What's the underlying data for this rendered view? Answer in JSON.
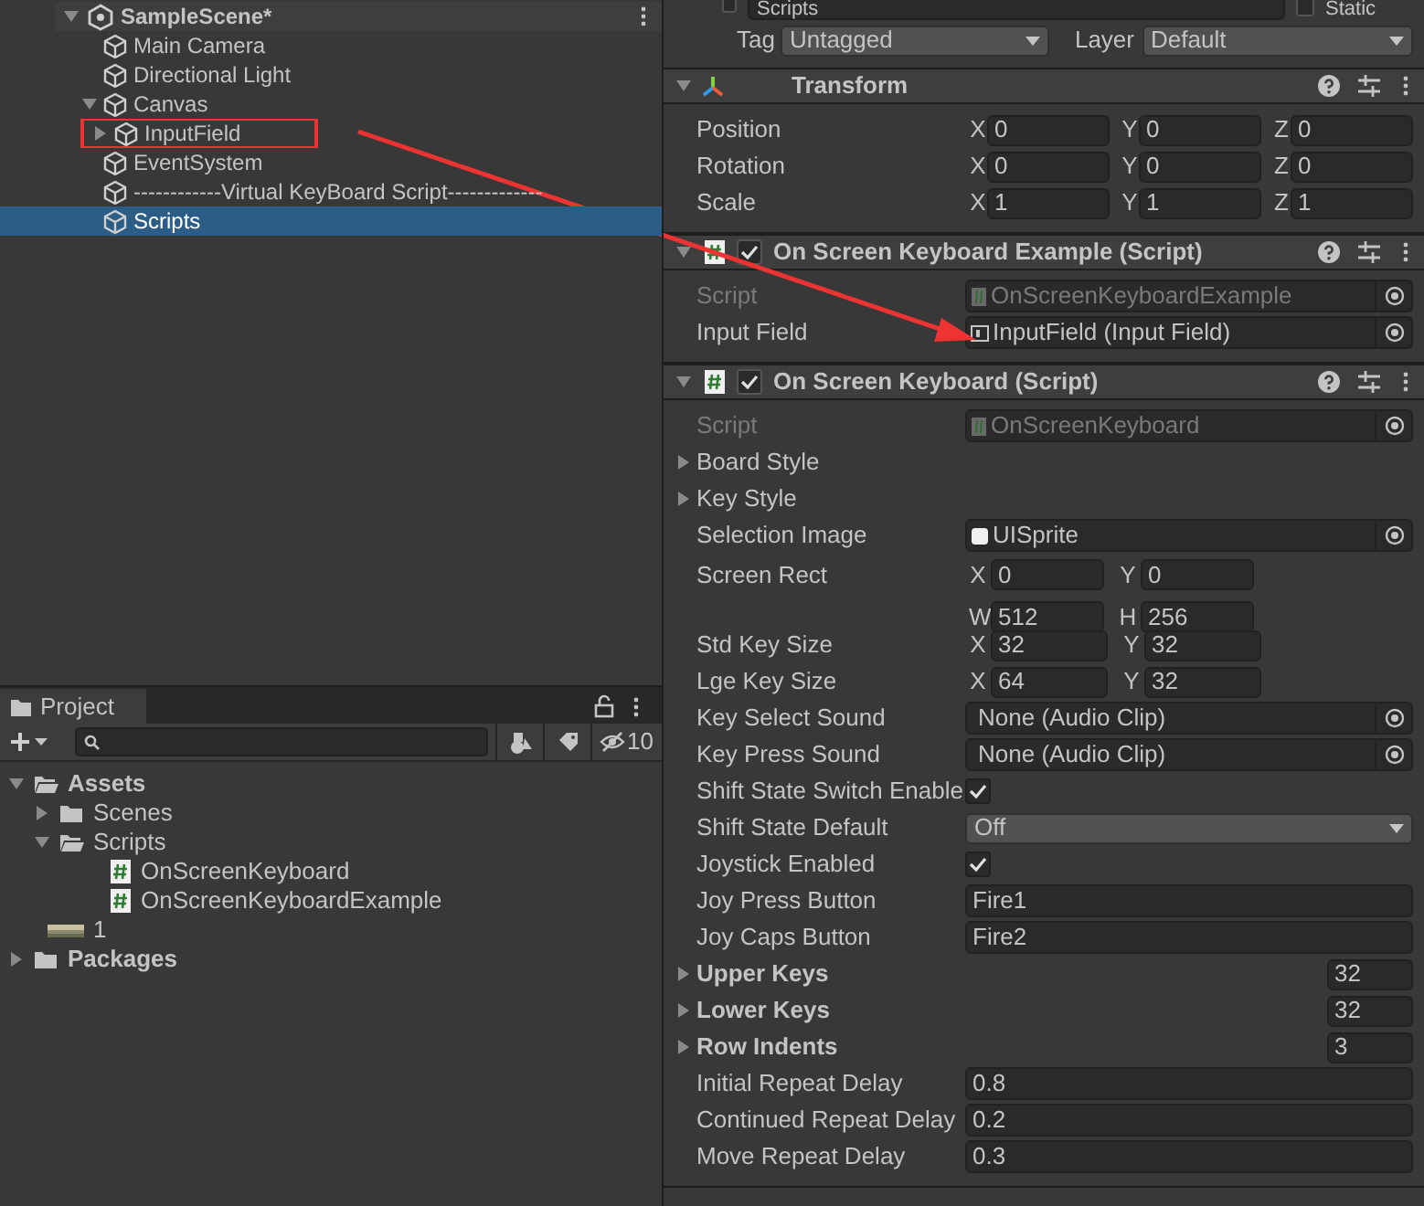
{
  "hierarchy": {
    "scene": "SampleScene*",
    "items": [
      {
        "name": "Main Camera",
        "selected": false,
        "annotated": false
      },
      {
        "name": "Directional Light",
        "selected": false,
        "annotated": false
      },
      {
        "name": "Canvas",
        "expanded": true,
        "selected": false,
        "annotated": false,
        "children": [
          {
            "name": "InputField",
            "expanded": false,
            "selected": false,
            "annotated": true
          }
        ]
      },
      {
        "name": "EventSystem",
        "selected": false,
        "annotated": false
      },
      {
        "name": "------------Virtual KeyBoard Script-------------",
        "selected": false,
        "annotated": false
      },
      {
        "name": "Scripts",
        "selected": true,
        "annotated": false
      }
    ]
  },
  "project": {
    "tab": "Project",
    "hidden_count": "10",
    "items": [
      {
        "name": "Assets",
        "kind": "folder",
        "bold": true,
        "expanded": true,
        "children": [
          {
            "name": "Scenes",
            "kind": "folder",
            "bold": false,
            "expanded": false
          },
          {
            "name": "Scripts",
            "kind": "folder",
            "bold": false,
            "expanded": true,
            "children": [
              {
                "name": "OnScreenKeyboard",
                "kind": "script",
                "bold": false
              },
              {
                "name": "OnScreenKeyboardExample",
                "kind": "script",
                "bold": false
              }
            ]
          },
          {
            "name": "1",
            "bold": false
          }
        ]
      },
      {
        "name": "Packages",
        "kind": "folder",
        "bold": true,
        "expanded": false
      }
    ]
  },
  "inspector": {
    "active": false,
    "name": "Scripts",
    "static": false,
    "static_label": "Static",
    "tag_label": "Tag",
    "tag": "Untagged",
    "layer_label": "Layer",
    "layer": "Default",
    "components": [
      {
        "title": "Transform",
        "kind": "transform",
        "rows": [
          {
            "kind": "vector3",
            "label": "Position",
            "fields": [
              {
                "axis": "X",
                "value": "0"
              },
              {
                "axis": "Y",
                "value": "0"
              },
              {
                "axis": "Z",
                "value": "0"
              }
            ]
          },
          {
            "kind": "vector3",
            "label": "Rotation",
            "fields": [
              {
                "axis": "X",
                "value": "0"
              },
              {
                "axis": "Y",
                "value": "0"
              },
              {
                "axis": "Z",
                "value": "0"
              }
            ]
          },
          {
            "kind": "vector3",
            "label": "Scale",
            "fields": [
              {
                "axis": "X",
                "value": "1"
              },
              {
                "axis": "Y",
                "value": "1"
              },
              {
                "axis": "Z",
                "value": "1"
              }
            ]
          }
        ]
      },
      {
        "title": "On Screen Keyboard Example (Script)",
        "kind": "script",
        "enabled": true,
        "rows": [
          {
            "kind": "script_ref",
            "label": "Script",
            "value": "OnScreenKeyboardExample",
            "disabled": true
          },
          {
            "kind": "component_ref",
            "label": "Input Field",
            "value": "InputField (Input Field)",
            "disabled": false
          }
        ]
      },
      {
        "title": "On Screen Keyboard (Script)",
        "kind": "script",
        "enabled": true,
        "rows": [
          {
            "kind": "script_ref",
            "label": "Script",
            "value": "OnScreenKeyboard",
            "disabled": true
          },
          {
            "kind": "foldout",
            "label": "Board Style",
            "expanded": false
          },
          {
            "kind": "foldout",
            "label": "Key Style",
            "expanded": false
          },
          {
            "kind": "sprite_ref",
            "label": "Selection Image",
            "value": "UISprite",
            "disabled": false
          },
          {
            "kind": "rect",
            "label": "Screen Rect",
            "fields": [
              {
                "axis": "X",
                "value": "0"
              },
              {
                "axis": "Y",
                "value": "0"
              },
              {
                "axis": "W",
                "value": "512"
              },
              {
                "axis": "H",
                "value": "256"
              }
            ]
          },
          {
            "kind": "vector2",
            "label": "Std Key Size",
            "fields": [
              {
                "axis": "X",
                "value": "32"
              },
              {
                "axis": "Y",
                "value": "32"
              }
            ]
          },
          {
            "kind": "vector2",
            "label": "Lge Key Size",
            "fields": [
              {
                "axis": "X",
                "value": "64"
              },
              {
                "axis": "Y",
                "value": "32"
              }
            ]
          },
          {
            "kind": "asset_ref",
            "label": "Key Select Sound",
            "value": "None (Audio Clip)",
            "disabled": false
          },
          {
            "kind": "asset_ref",
            "label": "Key Press Sound",
            "value": "None (Audio Clip)",
            "disabled": false
          },
          {
            "kind": "checkbox",
            "label": "Shift State Switch Enable",
            "checked": true
          },
          {
            "kind": "dropdown",
            "label": "Shift State Default",
            "value": "Off"
          },
          {
            "kind": "checkbox",
            "label": "Joystick Enabled",
            "checked": true
          },
          {
            "kind": "text",
            "label": "Joy Press Button",
            "value": "Fire1"
          },
          {
            "kind": "text",
            "label": "Joy Caps Button",
            "value": "Fire2"
          },
          {
            "kind": "array",
            "label": "Upper Keys",
            "expanded": false,
            "value": "32"
          },
          {
            "kind": "array",
            "label": "Lower Keys",
            "expanded": false,
            "value": "32"
          },
          {
            "kind": "array",
            "label": "Row Indents",
            "expanded": false,
            "value": "3"
          },
          {
            "kind": "text",
            "label": "Initial Repeat Delay",
            "value": "0.8"
          },
          {
            "kind": "text",
            "label": "Continued Repeat Delay",
            "value": "0.2"
          },
          {
            "kind": "text",
            "label": "Move Repeat Delay",
            "value": "0.3"
          }
        ]
      }
    ]
  }
}
